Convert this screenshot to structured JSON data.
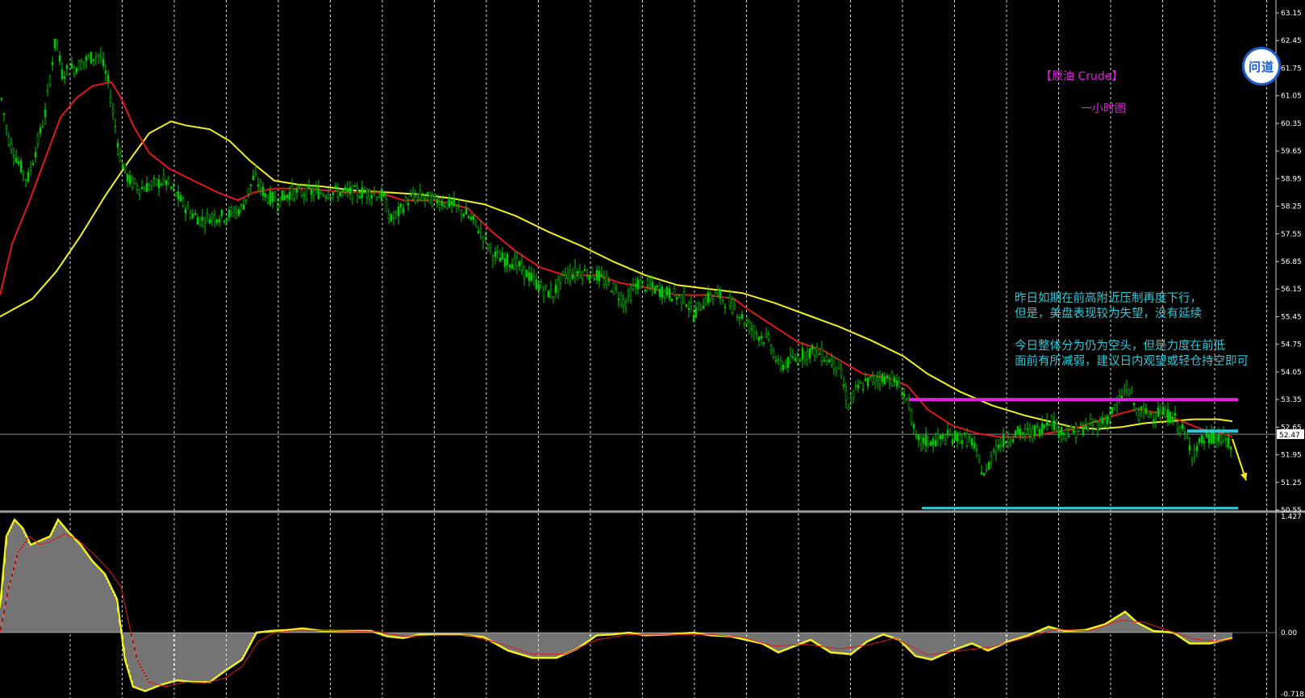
{
  "chart_data": [
    {
      "type": "candlestick",
      "title": "【原油 Crude】",
      "subtitle": "一小时图",
      "ylim": [
        50.55,
        63.15
      ],
      "price_axis_ticks": [
        "63.15",
        "62.45",
        "61.75",
        "61.05",
        "60.35",
        "59.65",
        "58.95",
        "58.25",
        "57.55",
        "56.85",
        "56.15",
        "55.45",
        "54.75",
        "54.05",
        "53.35",
        "52.65",
        "51.95",
        "51.25",
        "50.55"
      ],
      "current_price": 52.47,
      "current_price_label": "52.47",
      "grid": true,
      "colors": {
        "background": "#000000",
        "up": "#00c800",
        "down": "#00c800",
        "ma_fast": "#e01818",
        "ma_slow": "#f0f020",
        "resistance": "#e020e0",
        "support": "#2ec8d8",
        "arrow": "#f0f020",
        "grid": "#d8d8d8"
      },
      "price_path": [
        [
          0,
          61.2
        ],
        [
          10,
          60.0
        ],
        [
          22,
          59.4
        ],
        [
          34,
          58.9
        ],
        [
          46,
          59.8
        ],
        [
          56,
          60.6
        ],
        [
          64,
          61.8
        ],
        [
          70,
          62.6
        ],
        [
          76,
          61.6
        ],
        [
          84,
          61.7
        ],
        [
          96,
          61.8
        ],
        [
          110,
          62.0
        ],
        [
          124,
          62.1
        ],
        [
          134,
          61.4
        ],
        [
          142,
          60.4
        ],
        [
          150,
          59.4
        ],
        [
          160,
          58.9
        ],
        [
          175,
          58.7
        ],
        [
          190,
          58.8
        ],
        [
          205,
          58.9
        ],
        [
          220,
          58.5
        ],
        [
          235,
          58.1
        ],
        [
          250,
          57.9
        ],
        [
          262,
          58.0
        ],
        [
          280,
          58.0
        ],
        [
          300,
          58.2
        ],
        [
          315,
          59.0
        ],
        [
          330,
          58.5
        ],
        [
          345,
          58.4
        ],
        [
          360,
          58.6
        ],
        [
          380,
          58.6
        ],
        [
          400,
          58.6
        ],
        [
          420,
          58.6
        ],
        [
          440,
          58.6
        ],
        [
          460,
          58.6
        ],
        [
          475,
          58.5
        ],
        [
          485,
          57.9
        ],
        [
          495,
          58.1
        ],
        [
          505,
          58.4
        ],
        [
          520,
          58.5
        ],
        [
          540,
          58.4
        ],
        [
          560,
          58.3
        ],
        [
          575,
          58.1
        ],
        [
          590,
          57.8
        ],
        [
          602,
          57.4
        ],
        [
          612,
          57.0
        ],
        [
          625,
          56.9
        ],
        [
          640,
          56.8
        ],
        [
          655,
          56.5
        ],
        [
          670,
          56.2
        ],
        [
          685,
          56.0
        ],
        [
          700,
          56.5
        ],
        [
          720,
          56.6
        ],
        [
          740,
          56.5
        ],
        [
          760,
          56.2
        ],
        [
          775,
          55.8
        ],
        [
          790,
          56.3
        ],
        [
          805,
          56.2
        ],
        [
          820,
          56.1
        ],
        [
          835,
          56.0
        ],
        [
          850,
          55.9
        ],
        [
          860,
          55.5
        ],
        [
          875,
          55.9
        ],
        [
          890,
          56.0
        ],
        [
          910,
          55.7
        ],
        [
          925,
          55.3
        ],
        [
          940,
          55.0
        ],
        [
          955,
          54.8
        ],
        [
          965,
          54.2
        ],
        [
          980,
          54.3
        ],
        [
          995,
          54.5
        ],
        [
          1010,
          54.6
        ],
        [
          1025,
          54.4
        ],
        [
          1040,
          54.2
        ],
        [
          1052,
          53.2
        ],
        [
          1062,
          53.6
        ],
        [
          1075,
          53.8
        ],
        [
          1090,
          53.9
        ],
        [
          1105,
          53.9
        ],
        [
          1118,
          53.6
        ],
        [
          1128,
          53.2
        ],
        [
          1135,
          52.3
        ],
        [
          1145,
          52.3
        ],
        [
          1160,
          52.3
        ],
        [
          1175,
          52.4
        ],
        [
          1190,
          52.4
        ],
        [
          1205,
          52.3
        ],
        [
          1215,
          51.7
        ],
        [
          1222,
          51.4
        ],
        [
          1232,
          52.1
        ],
        [
          1245,
          52.3
        ],
        [
          1260,
          52.5
        ],
        [
          1275,
          52.5
        ],
        [
          1290,
          52.6
        ],
        [
          1302,
          52.9
        ],
        [
          1312,
          52.6
        ],
        [
          1325,
          52.5
        ],
        [
          1340,
          52.6
        ],
        [
          1355,
          52.7
        ],
        [
          1370,
          52.8
        ],
        [
          1385,
          53.2
        ],
        [
          1398,
          53.7
        ],
        [
          1410,
          53.0
        ],
        [
          1425,
          53.0
        ],
        [
          1440,
          53.0
        ],
        [
          1455,
          52.9
        ],
        [
          1468,
          52.5
        ],
        [
          1478,
          52.0
        ],
        [
          1490,
          52.3
        ],
        [
          1505,
          52.4
        ],
        [
          1520,
          52.3
        ],
        [
          1528,
          52.1
        ]
      ],
      "ma_fast": [
        [
          0,
          56.0
        ],
        [
          15,
          57.3
        ],
        [
          35,
          58.3
        ],
        [
          55,
          59.4
        ],
        [
          75,
          60.5
        ],
        [
          95,
          61.0
        ],
        [
          115,
          61.3
        ],
        [
          138,
          61.4
        ],
        [
          150,
          61.0
        ],
        [
          165,
          60.3
        ],
        [
          185,
          59.6
        ],
        [
          210,
          59.2
        ],
        [
          240,
          58.9
        ],
        [
          270,
          58.6
        ],
        [
          295,
          58.4
        ],
        [
          315,
          58.6
        ],
        [
          340,
          58.7
        ],
        [
          380,
          58.7
        ],
        [
          430,
          58.6
        ],
        [
          470,
          58.6
        ],
        [
          500,
          58.4
        ],
        [
          540,
          58.4
        ],
        [
          580,
          58.2
        ],
        [
          610,
          57.6
        ],
        [
          640,
          57.1
        ],
        [
          670,
          56.7
        ],
        [
          700,
          56.5
        ],
        [
          740,
          56.5
        ],
        [
          770,
          56.3
        ],
        [
          800,
          56.2
        ],
        [
          840,
          56.0
        ],
        [
          880,
          56.0
        ],
        [
          910,
          55.9
        ],
        [
          930,
          55.6
        ],
        [
          960,
          55.2
        ],
        [
          990,
          54.8
        ],
        [
          1020,
          54.6
        ],
        [
          1045,
          54.3
        ],
        [
          1070,
          54.0
        ],
        [
          1100,
          53.9
        ],
        [
          1125,
          53.7
        ],
        [
          1150,
          53.1
        ],
        [
          1180,
          52.7
        ],
        [
          1210,
          52.5
        ],
        [
          1240,
          52.4
        ],
        [
          1275,
          52.4
        ],
        [
          1300,
          52.5
        ],
        [
          1330,
          52.6
        ],
        [
          1360,
          52.8
        ],
        [
          1390,
          53.0
        ],
        [
          1410,
          53.1
        ],
        [
          1440,
          53.0
        ],
        [
          1465,
          52.8
        ],
        [
          1490,
          52.6
        ],
        [
          1515,
          52.5
        ],
        [
          1528,
          52.4
        ]
      ],
      "ma_slow": [
        [
          0,
          55.45
        ],
        [
          40,
          55.9
        ],
        [
          70,
          56.6
        ],
        [
          100,
          57.5
        ],
        [
          130,
          58.5
        ],
        [
          160,
          59.4
        ],
        [
          185,
          60.1
        ],
        [
          212,
          60.4
        ],
        [
          230,
          60.3
        ],
        [
          260,
          60.2
        ],
        [
          285,
          59.9
        ],
        [
          310,
          59.4
        ],
        [
          340,
          58.9
        ],
        [
          370,
          58.8
        ],
        [
          400,
          58.75
        ],
        [
          440,
          58.65
        ],
        [
          480,
          58.6
        ],
        [
          520,
          58.55
        ],
        [
          560,
          58.45
        ],
        [
          600,
          58.3
        ],
        [
          640,
          58.0
        ],
        [
          680,
          57.6
        ],
        [
          720,
          57.25
        ],
        [
          760,
          56.85
        ],
        [
          800,
          56.5
        ],
        [
          840,
          56.25
        ],
        [
          880,
          56.15
        ],
        [
          920,
          56.05
        ],
        [
          960,
          55.8
        ],
        [
          1000,
          55.5
        ],
        [
          1040,
          55.2
        ],
        [
          1080,
          54.85
        ],
        [
          1120,
          54.45
        ],
        [
          1150,
          54.0
        ],
        [
          1190,
          53.55
        ],
        [
          1230,
          53.2
        ],
        [
          1270,
          52.95
        ],
        [
          1300,
          52.8
        ],
        [
          1330,
          52.65
        ],
        [
          1360,
          52.6
        ],
        [
          1390,
          52.65
        ],
        [
          1420,
          52.75
        ],
        [
          1450,
          52.8
        ],
        [
          1480,
          52.85
        ],
        [
          1510,
          52.85
        ],
        [
          1528,
          52.8
        ]
      ],
      "resistance_level": 53.35,
      "resistance_span": [
        1127,
        1535
      ],
      "support_level": 50.6,
      "support_span": [
        1143,
        1535
      ],
      "short_level": 52.55,
      "short_span": [
        1472,
        1535
      ],
      "projection_arrow": [
        [
          1528,
          52.35
        ],
        [
          1545,
          51.3
        ]
      ],
      "annotations": [
        "昨日如期在前高附近压制再度下行，\n但是，美盘表现较为失望，没有延续",
        "今日整体分为仍为空头，但是力度在前低\n面前有所减弱，建议日内观望或轻仓持空即可"
      ]
    },
    {
      "type": "histogram",
      "indicator": "MACD",
      "ylim": [
        -0.718,
        1.427
      ],
      "axis_ticks": [
        "1.427",
        "0.00",
        "-0.718"
      ],
      "signal_main": [
        [
          0,
          0.3
        ],
        [
          8,
          1.15
        ],
        [
          18,
          1.35
        ],
        [
          28,
          1.25
        ],
        [
          38,
          1.05
        ],
        [
          50,
          1.1
        ],
        [
          62,
          1.15
        ],
        [
          72,
          1.35
        ],
        [
          85,
          1.2
        ],
        [
          100,
          1.05
        ],
        [
          115,
          0.85
        ],
        [
          130,
          0.7
        ],
        [
          145,
          0.4
        ],
        [
          155,
          -0.3
        ],
        [
          165,
          -0.6
        ],
        [
          180,
          -0.65
        ],
        [
          200,
          -0.58
        ],
        [
          220,
          -0.53
        ],
        [
          240,
          -0.55
        ],
        [
          260,
          -0.55
        ],
        [
          280,
          -0.42
        ],
        [
          300,
          -0.3
        ],
        [
          318,
          0.0
        ],
        [
          335,
          0.02
        ],
        [
          355,
          0.03
        ],
        [
          375,
          0.05
        ],
        [
          400,
          0.02
        ],
        [
          430,
          0.02
        ],
        [
          460,
          0.02
        ],
        [
          480,
          -0.04
        ],
        [
          500,
          -0.06
        ],
        [
          520,
          -0.02
        ],
        [
          545,
          -0.02
        ],
        [
          570,
          -0.02
        ],
        [
          600,
          -0.05
        ],
        [
          630,
          -0.2
        ],
        [
          660,
          -0.28
        ],
        [
          690,
          -0.28
        ],
        [
          715,
          -0.18
        ],
        [
          740,
          -0.03
        ],
        [
          760,
          -0.02
        ],
        [
          780,
          0.0
        ],
        [
          800,
          -0.03
        ],
        [
          830,
          -0.02
        ],
        [
          860,
          0.0
        ],
        [
          880,
          -0.03
        ],
        [
          905,
          -0.04
        ],
        [
          925,
          -0.08
        ],
        [
          945,
          -0.12
        ],
        [
          965,
          -0.22
        ],
        [
          985,
          -0.15
        ],
        [
          1005,
          -0.08
        ],
        [
          1030,
          -0.22
        ],
        [
          1055,
          -0.24
        ],
        [
          1075,
          -0.1
        ],
        [
          1095,
          -0.02
        ],
        [
          1115,
          -0.08
        ],
        [
          1135,
          -0.26
        ],
        [
          1155,
          -0.3
        ],
        [
          1180,
          -0.2
        ],
        [
          1205,
          -0.12
        ],
        [
          1225,
          -0.2
        ],
        [
          1250,
          -0.1
        ],
        [
          1275,
          -0.03
        ],
        [
          1300,
          0.07
        ],
        [
          1320,
          0.02
        ],
        [
          1345,
          0.03
        ],
        [
          1370,
          0.1
        ],
        [
          1395,
          0.25
        ],
        [
          1410,
          0.12
        ],
        [
          1430,
          0.02
        ],
        [
          1455,
          0.0
        ],
        [
          1475,
          -0.12
        ],
        [
          1500,
          -0.12
        ],
        [
          1528,
          -0.06
        ]
      ],
      "signal_red": [
        [
          0,
          0.0
        ],
        [
          10,
          0.5
        ],
        [
          22,
          0.95
        ],
        [
          36,
          1.15
        ],
        [
          50,
          1.05
        ],
        [
          65,
          1.1
        ],
        [
          80,
          1.18
        ],
        [
          95,
          1.12
        ],
        [
          115,
          0.95
        ],
        [
          135,
          0.75
        ],
        [
          150,
          0.55
        ],
        [
          160,
          0.1
        ],
        [
          170,
          -0.3
        ],
        [
          185,
          -0.55
        ],
        [
          205,
          -0.6
        ],
        [
          230,
          -0.55
        ],
        [
          255,
          -0.56
        ],
        [
          280,
          -0.5
        ],
        [
          300,
          -0.38
        ],
        [
          320,
          -0.1
        ],
        [
          340,
          0.0
        ],
        [
          370,
          0.03
        ],
        [
          420,
          0.02
        ],
        [
          470,
          0.01
        ],
        [
          500,
          -0.04
        ],
        [
          540,
          -0.03
        ],
        [
          580,
          -0.03
        ],
        [
          620,
          -0.12
        ],
        [
          660,
          -0.24
        ],
        [
          700,
          -0.24
        ],
        [
          740,
          -0.08
        ],
        [
          780,
          -0.02
        ],
        [
          830,
          -0.02
        ],
        [
          880,
          -0.02
        ],
        [
          920,
          -0.05
        ],
        [
          960,
          -0.15
        ],
        [
          1000,
          -0.13
        ],
        [
          1040,
          -0.18
        ],
        [
          1075,
          -0.14
        ],
        [
          1110,
          -0.06
        ],
        [
          1150,
          -0.25
        ],
        [
          1190,
          -0.2
        ],
        [
          1230,
          -0.16
        ],
        [
          1270,
          -0.06
        ],
        [
          1310,
          0.04
        ],
        [
          1350,
          0.02
        ],
        [
          1390,
          0.15
        ],
        [
          1420,
          0.12
        ],
        [
          1450,
          0.02
        ],
        [
          1480,
          -0.07
        ],
        [
          1510,
          -0.1
        ],
        [
          1528,
          -0.07
        ]
      ]
    }
  ],
  "logo": {
    "text": "问道"
  }
}
